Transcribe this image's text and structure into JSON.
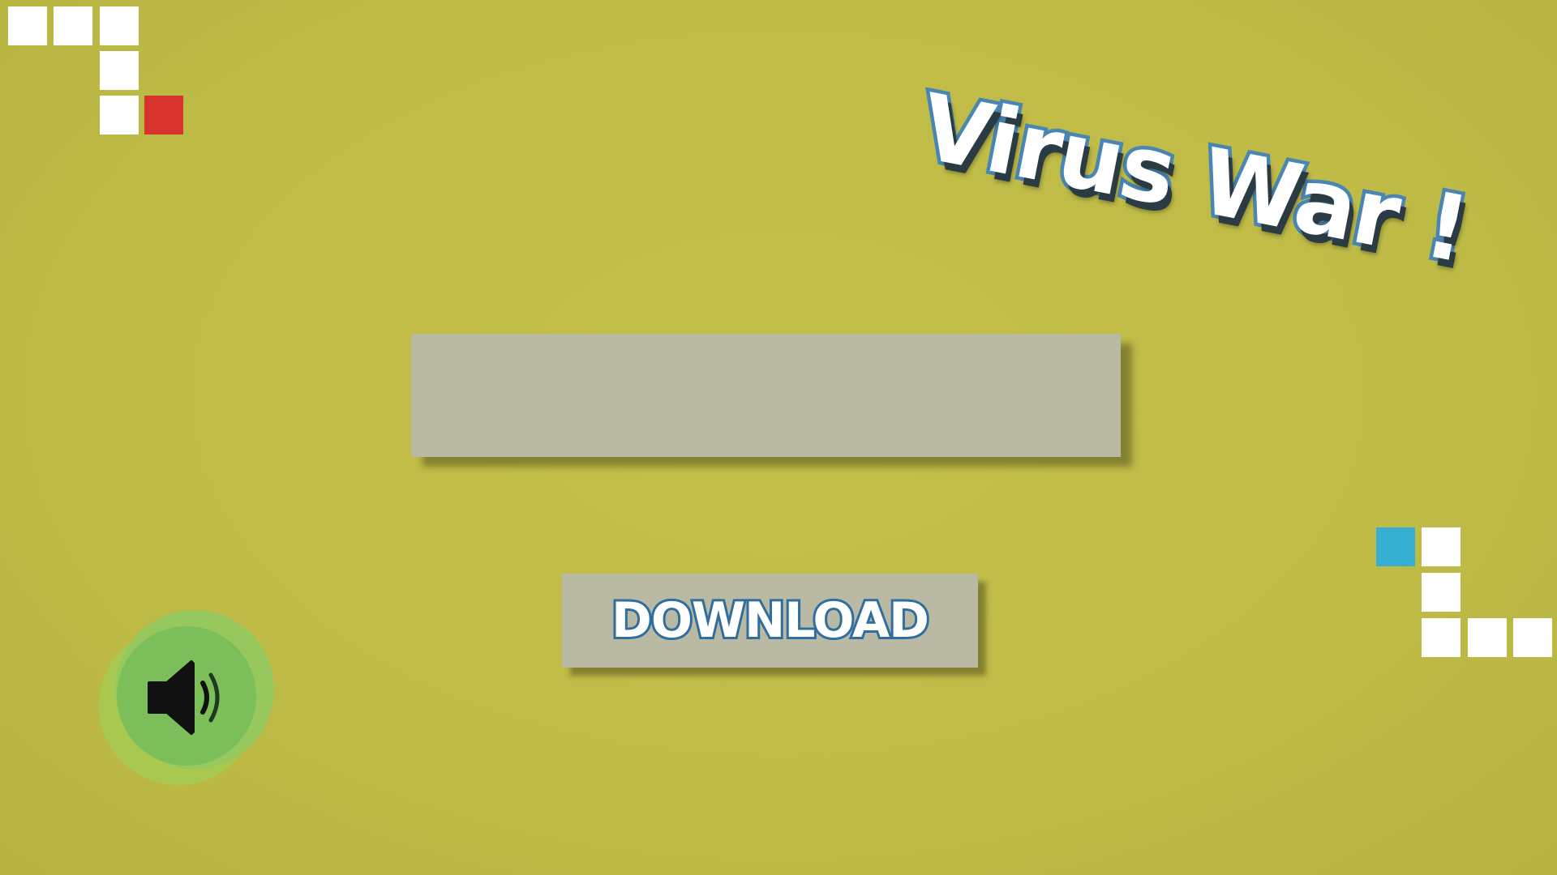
{
  "game": {
    "title": "Virus War !",
    "download_label": "DOWNLOAD",
    "panel_text": ""
  },
  "icons": {
    "sound": "speaker-volume-icon"
  },
  "colors": {
    "background": "#bfbc47",
    "panel": "#b9b9a4",
    "title_outline": "#4a86b3",
    "download_outline": "#2f6e9e",
    "block_white": "#ffffff",
    "block_red": "#d8322c",
    "block_cyan": "#35b0d2",
    "sound_button": "#7cbf5a"
  }
}
